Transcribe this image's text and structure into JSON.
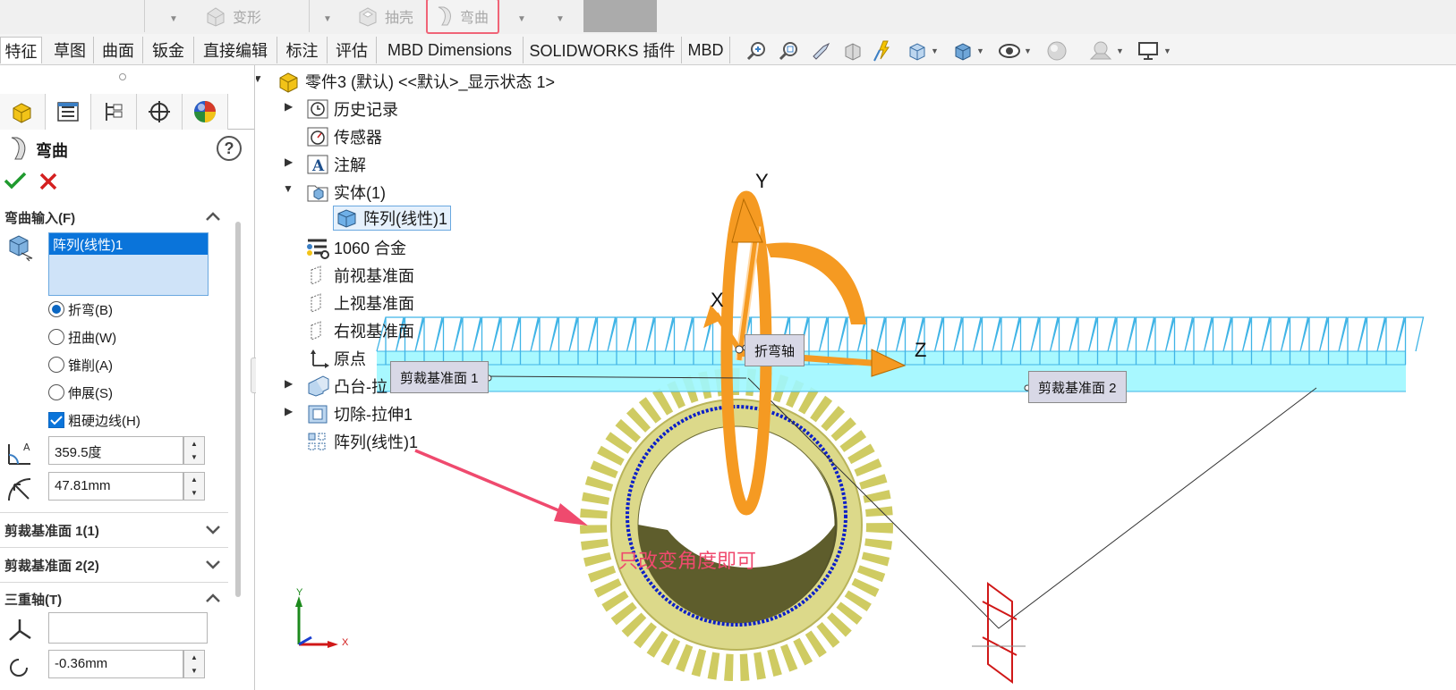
{
  "ribbon": {
    "deform_label": "变形",
    "shell_label": "抽壳",
    "bend_label": "弯曲"
  },
  "tabs": [
    "特征",
    "草图",
    "曲面",
    "钣金",
    "直接编辑",
    "标注",
    "评估",
    "MBD Dimensions",
    "SOLIDWORKS 插件",
    "MBD"
  ],
  "property_manager": {
    "title": "弯曲",
    "bend_input_header": "弯曲输入(F)",
    "selected_body": "阵列(线性)1",
    "options": [
      {
        "label": "折弯(B)",
        "selected": true
      },
      {
        "label": "扭曲(W)",
        "selected": false
      },
      {
        "label": "锥削(A)",
        "selected": false
      },
      {
        "label": "伸展(S)",
        "selected": false
      }
    ],
    "hard_edges_label": "粗硬边线(H)",
    "angle_value": "359.5度",
    "radius_value": "47.81mm",
    "trim_plane1_header": "剪裁基准面 1(1)",
    "trim_plane2_header": "剪裁基准面 2(2)",
    "triad_header": "三重轴(T)",
    "triad_value": "",
    "triad_offset": "-0.36mm"
  },
  "feature_tree": {
    "root": "零件3 (默认) <<默认>_显示状态 1>",
    "items": {
      "history": "历史记录",
      "sensors": "传感器",
      "annotations": "注解",
      "solid_bodies": "实体(1)",
      "pattern_body": "阵列(线性)1",
      "material": "1060 合金",
      "front_plane": "前视基准面",
      "top_plane": "上视基准面",
      "right_plane": "右视基准面",
      "origin": "原点",
      "boss_extrude": "凸台-拉",
      "cut_extrude": "切除-拉伸1",
      "linear_pattern": "阵列(线性)1"
    }
  },
  "viewport": {
    "callout_trim1": "剪裁基准面 1",
    "callout_trim2": "剪裁基准面 2",
    "callout_bend_axis": "折弯轴",
    "axis_y": "Y",
    "axis_x": "X",
    "axis_z": "Z",
    "annotation_text": "只改变角度即可",
    "triad_mini_y": "Y",
    "triad_mini_x": "X"
  },
  "colors": {
    "selection_blue": "#0a74da",
    "annotation_pink": "#ef4a6e",
    "rack_cyan": "#9ff7ff",
    "gear_yellow": "#dcd98a",
    "triad_orange": "#f59a22"
  }
}
